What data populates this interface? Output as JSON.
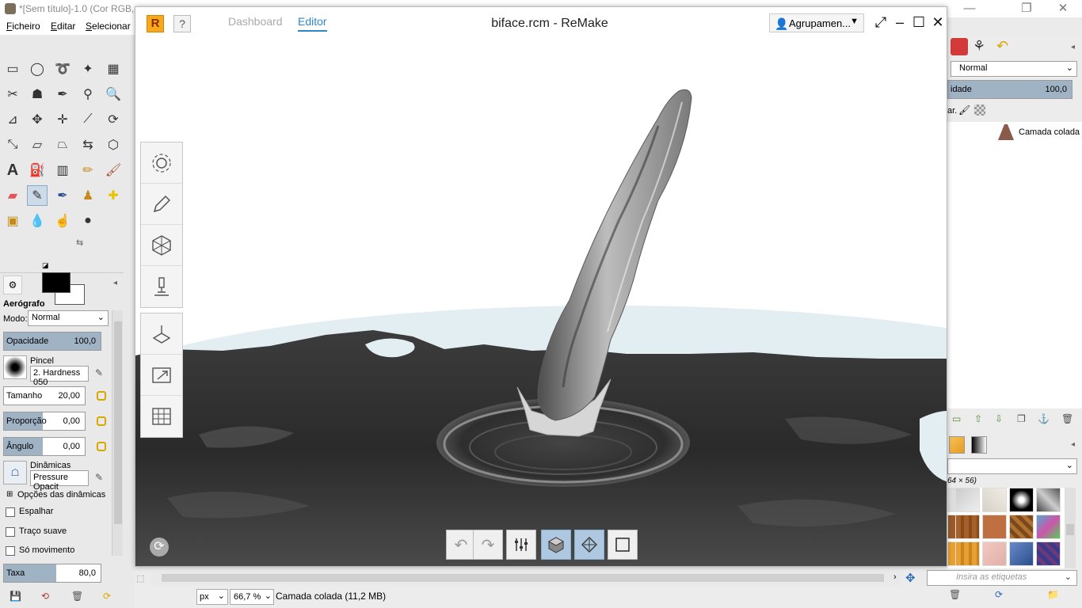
{
  "gimp": {
    "window_title": "*[Sem título]-1.0 (Cor RGB,",
    "menu": [
      "Ficheiro",
      "Editar",
      "Selecionar"
    ],
    "tool_options": {
      "title": "Aerógrafo",
      "mode_label": "Modo:",
      "mode_value": "Normal",
      "opacity_label": "Opacidade",
      "opacity_value": "100,0",
      "brush_label": "Pincel",
      "brush_value": "2. Hardness 050",
      "size_label": "Tamanho",
      "size_value": "20,00",
      "ratio_label": "Proporção",
      "ratio_value": "0,00",
      "angle_label": "Ângulo",
      "angle_value": "0,00",
      "dynamics_label": "Dinâmicas",
      "dynamics_value": "Pressure Opacit",
      "dynamics_options": "Opções das dinâmicas",
      "spread": "Espalhar",
      "smooth": "Traço suave",
      "motion_only": "Só movimento",
      "rate_label": "Taxa",
      "rate_value": "80,0"
    },
    "layers": {
      "mode_value": "Normal",
      "opacity_label": "idade",
      "opacity_value": "100,0",
      "lock_label": "ar.",
      "layer_name": "Camada colada"
    },
    "patterns": {
      "size_label": "64 × 56)",
      "tags_placeholder": "Insira as etiquetas"
    },
    "status": {
      "unit": "px",
      "zoom": "66,7 %",
      "layer_info": "Camada colada (11,2 MB)"
    }
  },
  "remake": {
    "title": "biface.rcm - ReMake",
    "tabs": [
      {
        "label": "Dashboard"
      },
      {
        "label": "Editor"
      }
    ],
    "logo": "R",
    "help": "?",
    "user": "Agrupamen..."
  },
  "colors": {
    "accent": "#2f86c5",
    "sky": "#e3eef3",
    "gimp_bg": "#ebebeb"
  }
}
